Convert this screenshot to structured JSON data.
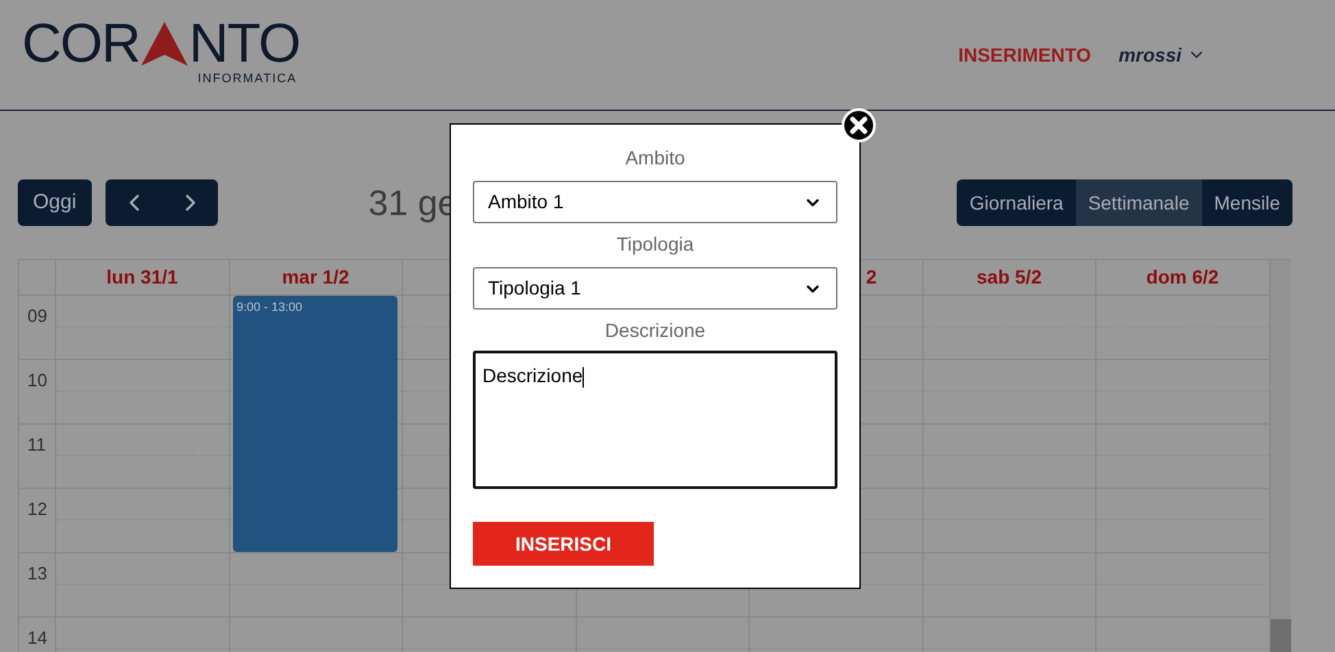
{
  "header": {
    "logo": {
      "left": "COR",
      "right": "NTO",
      "subtitle": "INFORMATICA"
    },
    "nav_link": "INSERIMENTO",
    "user": "mrossi"
  },
  "toolbar": {
    "today": "Oggi",
    "title": "31 ge",
    "views": [
      {
        "label": "Giornaliera",
        "selected": false
      },
      {
        "label": "Settimanale",
        "selected": true
      },
      {
        "label": "Mensile",
        "selected": false
      }
    ]
  },
  "calendar": {
    "columns": [
      {
        "label": "lun 31/1"
      },
      {
        "label": "mar 1/2",
        "events": [
          {
            "time": "9:00 - 13:00"
          }
        ]
      },
      {},
      {},
      {
        "label": "2",
        "kind": "cut"
      },
      {
        "label": "sab 5/2"
      },
      {
        "label": "dom 6/2"
      }
    ],
    "hours": [
      "09",
      "10",
      "11",
      "12",
      "13",
      "14"
    ]
  },
  "dialog": {
    "fields": [
      {
        "label": "Ambito",
        "kind": "select",
        "value": "Ambito 1"
      },
      {
        "label": "Tipologia",
        "kind": "select",
        "value": "Tipologia 1"
      },
      {
        "label": "Descrizione",
        "kind": "textarea",
        "value": "Descrizione"
      }
    ],
    "submit": "INSERISCI"
  }
}
